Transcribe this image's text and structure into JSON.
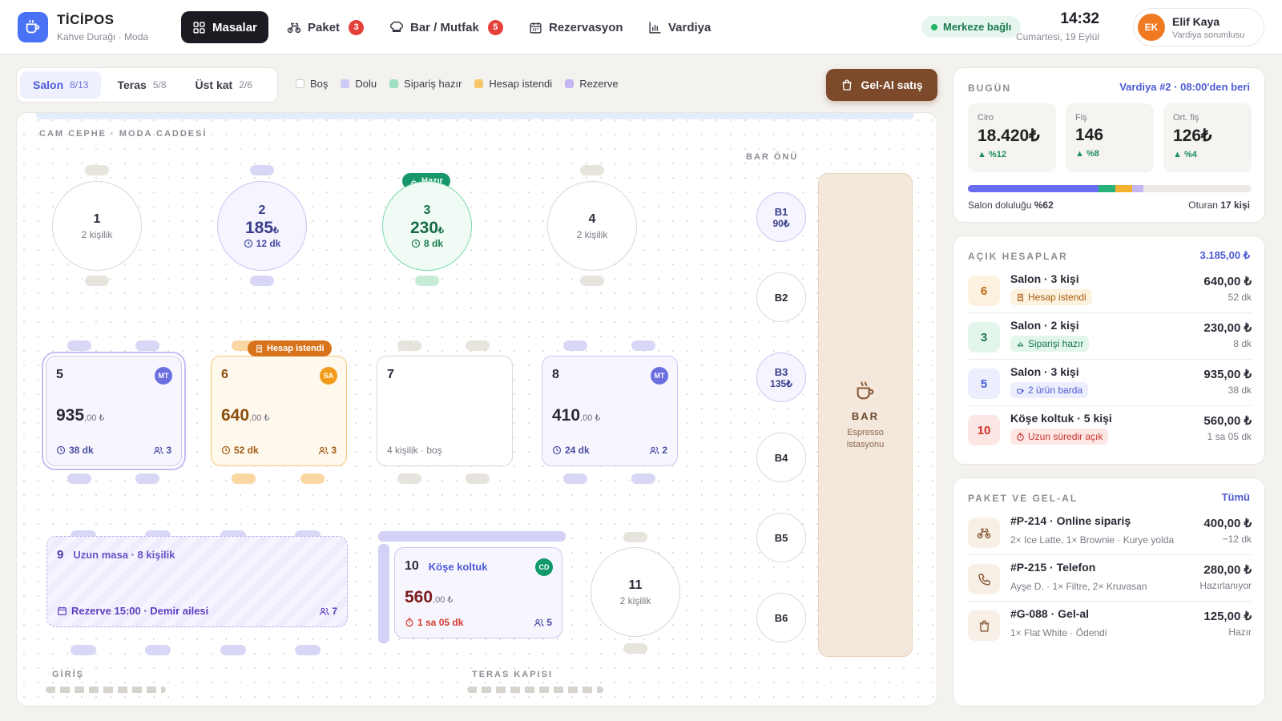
{
  "header": {
    "brand": "TİCİPOS",
    "branch": "Kahve Durağı · Moda",
    "nav": [
      {
        "label": "Masalar",
        "badge": ""
      },
      {
        "label": "Paket",
        "badge": "3"
      },
      {
        "label": "Bar / Mutfak",
        "badge": "5"
      },
      {
        "label": "Rezervasyon",
        "badge": ""
      },
      {
        "label": "Vardiya",
        "badge": ""
      }
    ],
    "connection": "Merkeze bağlı",
    "time": "14:32",
    "date": "Cumartesi, 19 Eylül",
    "user": {
      "initials": "EK",
      "name": "Elif Kaya",
      "role": "Vardiya sorumlusu"
    }
  },
  "toolbar": {
    "tabs": [
      {
        "label": "Salon",
        "count": "8/13"
      },
      {
        "label": "Teras",
        "count": "5/8"
      },
      {
        "label": "Üst kat",
        "count": "2/6"
      }
    ],
    "legend": [
      {
        "label": "Boş",
        "color": "#ffffff"
      },
      {
        "label": "Dolu",
        "color": "#cdcaf6"
      },
      {
        "label": "Sipariş hazır",
        "color": "#9fe0c0"
      },
      {
        "label": "Hesap istendi",
        "color": "#f7c66a"
      },
      {
        "label": "Rezerve",
        "color": "#c5b5f3"
      }
    ],
    "takeaway_button": "Gel-Al satış"
  },
  "floor": {
    "zone_window": "CAM CEPHE · MODA CADDESİ",
    "zone_bar": "BAR ÖNÜ",
    "zone_entry": "GİRİŞ",
    "zone_terrace_door": "TERAS KAPISI",
    "tables": {
      "t1": {
        "num": "1",
        "cap": "2 kişilik"
      },
      "t2": {
        "num": "2",
        "amount": "185",
        "cur": "₺",
        "time": "12 dk"
      },
      "t3": {
        "num": "3",
        "amount": "230",
        "cur": "₺",
        "time": "8 dk",
        "tag": "Hazır"
      },
      "t4": {
        "num": "4",
        "cap": "2 kişilik"
      },
      "t5": {
        "num": "5",
        "amount": "935",
        "dec": ",00 ₺",
        "time": "38 dk",
        "people": "3",
        "waiter": "MT"
      },
      "t6": {
        "num": "6",
        "amount": "640",
        "dec": ",00 ₺",
        "time": "52 dk",
        "people": "3",
        "waiter": "SA",
        "tag": "Hesap istendi"
      },
      "t7": {
        "num": "7",
        "cap": "4 kişilik · boş"
      },
      "t8": {
        "num": "8",
        "amount": "410",
        "dec": ",00 ₺",
        "time": "24 dk",
        "people": "2",
        "waiter": "MT"
      },
      "t9": {
        "num": "9",
        "name": "Uzun masa · 8 kişilik",
        "reserve": "Rezerve 15:00 · Demir ailesi",
        "people": "7"
      },
      "t10": {
        "num": "10",
        "name": "Köşe koltuk",
        "amount": "560",
        "dec": ",00 ₺",
        "time": "1 sa 05 dk",
        "people": "5",
        "waiter": "CD"
      },
      "t11": {
        "num": "11",
        "cap": "2 kişilik"
      }
    },
    "stools": [
      {
        "label": "B1",
        "amount": "90₺"
      },
      {
        "label": "B2",
        "amount": ""
      },
      {
        "label": "B3",
        "amount": "135₺"
      },
      {
        "label": "B4",
        "amount": ""
      },
      {
        "label": "B5",
        "amount": ""
      },
      {
        "label": "B6",
        "amount": ""
      }
    ],
    "bar": {
      "title": "BAR",
      "sub1": "Espresso",
      "sub2": "istasyonu"
    }
  },
  "today": {
    "title": "BUGÜN",
    "shift": "Vardiya #2 · 08:00'den beri",
    "kpis": [
      {
        "label": "Ciro",
        "value": "18.420₺",
        "delta": "%12"
      },
      {
        "label": "Fiş",
        "value": "146",
        "delta": "%8"
      },
      {
        "label": "Ort. fiş",
        "value": "126₺",
        "delta": "%4"
      }
    ],
    "occupancy_label": "Salon doluluğu",
    "occupancy_value": "%62",
    "occupancy_segments": [
      {
        "color": "#6a6cf0",
        "share": 0.46
      },
      {
        "color": "#27b27a",
        "share": 0.06
      },
      {
        "color": "#f5b22e",
        "share": 0.06
      },
      {
        "color": "#c5b5f3",
        "share": 0.04
      }
    ],
    "seated_label": "Oturan",
    "seated_value": "17 kişi"
  },
  "open_bills": {
    "title": "AÇIK HESAPLAR",
    "total": "3.185,00 ₺",
    "items": [
      {
        "table": "6",
        "title": "Salon · 3 kişi",
        "status": "Hesap istendi",
        "amount": "640,00 ₺",
        "time": "52 dk"
      },
      {
        "table": "3",
        "title": "Salon · 2 kişi",
        "status": "Siparişi hazır",
        "amount": "230,00 ₺",
        "time": "8 dk"
      },
      {
        "table": "5",
        "title": "Salon · 3 kişi",
        "status": "2 ürün barda",
        "amount": "935,00 ₺",
        "time": "38 dk"
      },
      {
        "table": "10",
        "title": "Köşe koltuk · 5 kişi",
        "status": "Uzun süredir açık",
        "amount": "560,00 ₺",
        "time": "1 sa 05 dk"
      }
    ]
  },
  "takeaway": {
    "title": "PAKET VE GEL-AL",
    "link": "Tümü",
    "items": [
      {
        "icon": "bike-icon",
        "title": "#P-214 · Online sipariş",
        "sub": "2× Ice Latte, 1× Brownie · Kurye yolda",
        "amount": "400,00 ₺",
        "status": "~12 dk"
      },
      {
        "icon": "phone-icon",
        "title": "#P-215 · Telefon",
        "sub": "Ayşe D. · 1× Filtre, 2× Kruvasan",
        "amount": "280,00 ₺",
        "status": "Hazırlanıyor"
      },
      {
        "icon": "bag-icon",
        "title": "#G-088 · Gel-al",
        "sub": "1× Flat White · Ödendi",
        "amount": "125,00 ₺",
        "status": "Hazır"
      }
    ]
  }
}
